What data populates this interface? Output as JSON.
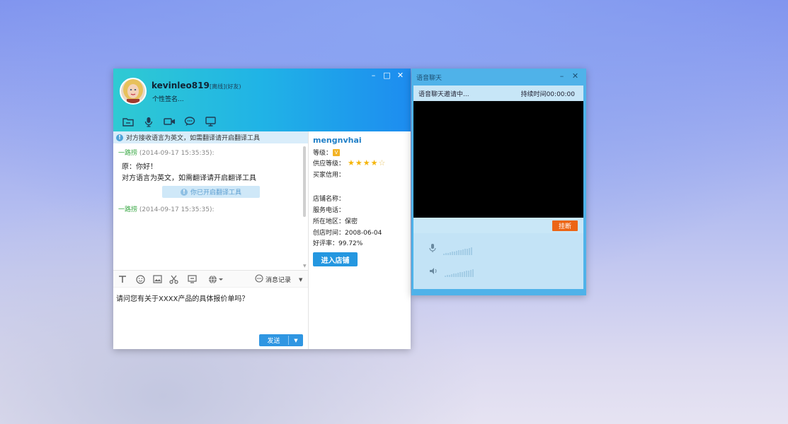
{
  "chat_window": {
    "username": "kevinleo819",
    "status": "[离线](好友)",
    "signature": "个性签名...",
    "controls": {
      "minimize": "–",
      "maximize": "□",
      "close": "✕"
    },
    "notice": "对方接收语言为英文，如需翻译请开启翻译工具",
    "messages": [
      {
        "sender": "一路捞",
        "time": "(2014-09-17 15:35:35):",
        "lines": [
          "原：你好！",
          "对方语言为英文，如需翻译请开启翻译工具"
        ],
        "translate_button": "你已开启翻译工具"
      },
      {
        "sender": "一路捞",
        "time": "(2014-09-17 15:35:35):"
      }
    ],
    "history_label": "消息记录",
    "input_text": "请问您有关于XXXX产品的具体报价单吗？",
    "send_label": "发送"
  },
  "seller": {
    "name": "mengnvhai",
    "level_label": "等级：",
    "supplier_level_label": "供应等级：",
    "buyer_credit_label": "买家信用：",
    "shop_name_label": "店铺名称：",
    "service_phone_label": "服务电话：",
    "region": "所在地区：保密",
    "founded": "创店时间：2008-06-04",
    "rating": "好评率：99.72%",
    "stars": 4,
    "enter_shop": "进入店铺"
  },
  "voice_window": {
    "title": "语音聊天",
    "controls": {
      "minimize": "–",
      "close": "✕"
    },
    "status": "语音聊天邀请中...",
    "duration": "持续时间00:00:00",
    "hangup": "挂断"
  },
  "icons": [
    "folder-icon",
    "microphone-icon",
    "video-camera-icon",
    "chat-bubbles-icon",
    "monitor-icon",
    "text-format-icon",
    "emoji-icon",
    "image-icon",
    "scissors-icon",
    "screenshot-icon",
    "translate-globe-icon",
    "history-icon",
    "speaker-icon"
  ]
}
